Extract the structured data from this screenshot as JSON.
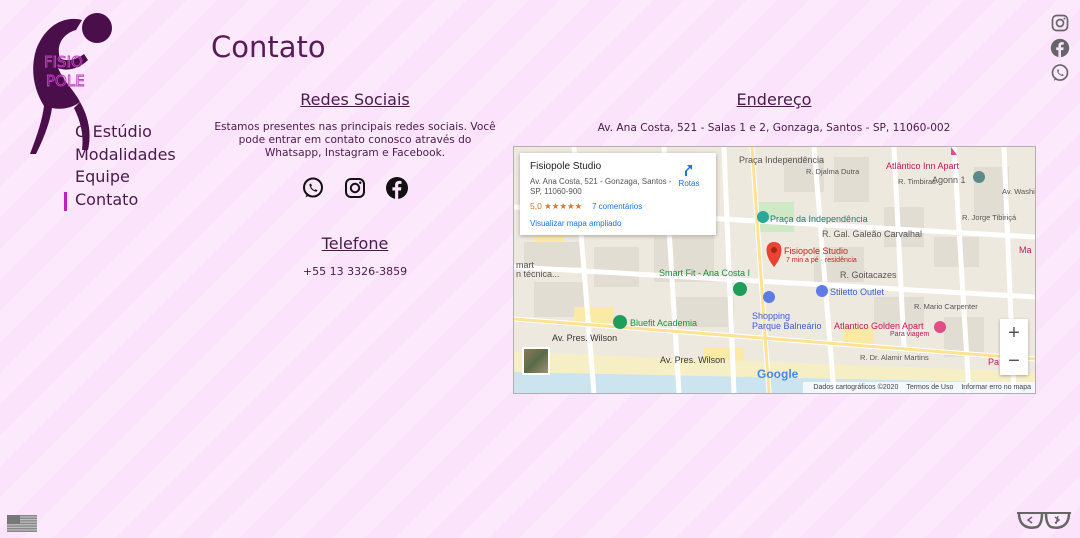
{
  "brand": {
    "logo_word_1": "FISIO",
    "logo_word_2": "POLE",
    "accent": "#c020c0",
    "dark": "#4a1a4a",
    "figure_color": "#4a0e4a"
  },
  "nav": {
    "items": [
      {
        "label": "O Estúdio"
      },
      {
        "label": "Modalidades"
      },
      {
        "label": "Equipe"
      },
      {
        "label": "Contato"
      }
    ],
    "active": "Contato"
  },
  "page": {
    "title": "Contato"
  },
  "social": {
    "title": "Redes Sociais",
    "description": "Estamos presentes nas principais redes sociais. Você pode entrar em contato conosco através do Whatsapp, Instagram e Facebook.",
    "icons": [
      "whatsapp-icon",
      "instagram-icon",
      "facebook-icon"
    ]
  },
  "phone": {
    "title": "Telefone",
    "number": "+55 13 3326-3859"
  },
  "address": {
    "title": "Endereço",
    "text": "Av. Ana Costa, 521 - Salas 1 e 2, Gonzaga, Santos - SP, 11060-002"
  },
  "map": {
    "card": {
      "name": "Fisiopole Studio",
      "address": "Av. Ana Costa, 521 - Gonzaga, Santos - SP, 11060-900",
      "rating": "5,0 ★★★★★",
      "reviews": "7 comentários",
      "routes": "Rotas",
      "enlarge": "Visualizar mapa ampliado"
    },
    "labels": {
      "praca_top": "Praça Independência",
      "atlantico_inn": "Atlântico Inn Apart",
      "agenor": "Agonn 1",
      "washington": "Av. Washington Luiz",
      "djalma": "R. Djalma Dutra",
      "timbiras": "R. Timbiras",
      "jorge": "R. Jorge Tibiriçá",
      "praca_ind": "Praça da Independência",
      "galeao": "R. Gal. Galeão Carvalhal",
      "marker": "Fisiopole Studio",
      "marker_sub": "7 min a pé · residência",
      "goitacazes": "R. Goitacazes",
      "smartfit": "Smart Fit - Ana Costa I",
      "mart": "mart",
      "tecnica": "n técnica...",
      "stiletto": "Stiletto Outlet",
      "shopping_1": "Shopping",
      "shopping_2": "Parque Balneário",
      "bluefit": "Bluefit Academia",
      "marcarpenter": "R. Mario Carpenter",
      "golden": "Atlantico Golden Apart",
      "golden_sub": "Para viagem",
      "pres1": "Av. Pres. Wilson",
      "pres2": "Av. Pres. Wilson",
      "martins": "R. Dr. Alamir Martins",
      "pa": "Pa",
      "ma": "Ma"
    },
    "google": "Google",
    "attribution": {
      "data": "Dados cartográficos ©2020",
      "terms": "Termos de Uso",
      "report": "Informar erro no mapa"
    },
    "zoom_in": "+",
    "zoom_out": "−"
  },
  "corner": {
    "top_icons": [
      "instagram-icon",
      "facebook-icon",
      "whatsapp-icon"
    ],
    "language_flag": "us-flag-icon",
    "developer_logo": "developer-glasses-icon"
  }
}
